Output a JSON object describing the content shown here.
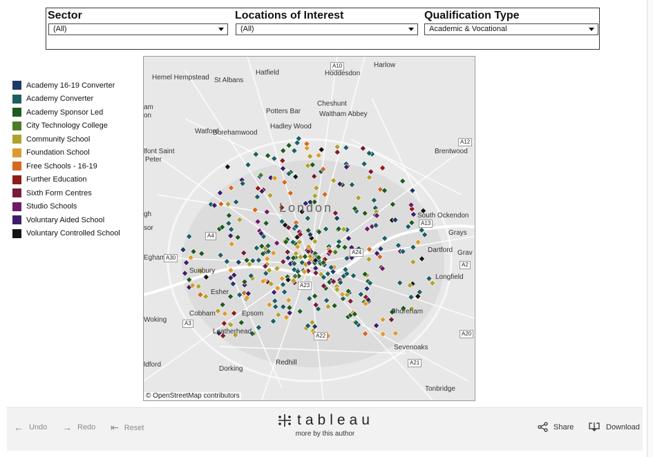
{
  "filters": {
    "sector": {
      "label": "Sector",
      "value": "(All)"
    },
    "locations": {
      "label": "Locations of Interest",
      "value": "(All)"
    },
    "qualification": {
      "label": "Qualification Type",
      "value": "Academic & Vocational"
    }
  },
  "legend": [
    {
      "label": "Academy 16-19 Converter",
      "color": "#1f3a68"
    },
    {
      "label": "Academy Converter",
      "color": "#1c5e62"
    },
    {
      "label": "Academy Sponsor Led",
      "color": "#1f5a22"
    },
    {
      "label": "City Technology College",
      "color": "#4e7a26"
    },
    {
      "label": "Community School",
      "color": "#b0a22e"
    },
    {
      "label": "Foundation School",
      "color": "#dd9a2e"
    },
    {
      "label": "Free Schools - 16-19",
      "color": "#d4691f"
    },
    {
      "label": "Further Education",
      "color": "#8e1c16"
    },
    {
      "label": "Sixth Form Centres",
      "color": "#7a1a3a"
    },
    {
      "label": "Studio Schools",
      "color": "#6e1a6a"
    },
    {
      "label": "Voluntary Aided School",
      "color": "#3e1e6a"
    },
    {
      "label": "Voluntary Controlled School",
      "color": "#141414"
    }
  ],
  "map": {
    "places": [
      "Hemel Hempstead",
      "St Albans",
      "Hatfield",
      "Harlow",
      "Hoddesdon",
      "Cheshunt",
      "Potters Bar",
      "Waltham Abbey",
      "Hadley Wood",
      "Watford",
      "Borehamwood",
      "Brentwood",
      "South Ockendon",
      "Grays",
      "Dartford",
      "Longfield",
      "Sunbury",
      "Esher",
      "Epsom",
      "Cobham",
      "Shoreham",
      "Leatherhead",
      "Dorking",
      "Redhill",
      "Sevenoaks",
      "Tonbridge",
      "Egham",
      "Woking",
      "Grav",
      "Peter",
      "lfont Saint",
      "am",
      "on",
      "gh",
      "sor",
      "ldford",
      "London"
    ],
    "roads": [
      "A10",
      "A12",
      "A13",
      "A2",
      "A20",
      "A21",
      "A22",
      "A23",
      "A24",
      "A3",
      "A30",
      "A4"
    ],
    "attribution": "© OpenStreetMap contributors"
  },
  "toolbar": {
    "undo": "Undo",
    "redo": "Redo",
    "reset": "Reset",
    "logo": "tableau",
    "more": "more by this author",
    "share": "Share",
    "download": "Download"
  }
}
